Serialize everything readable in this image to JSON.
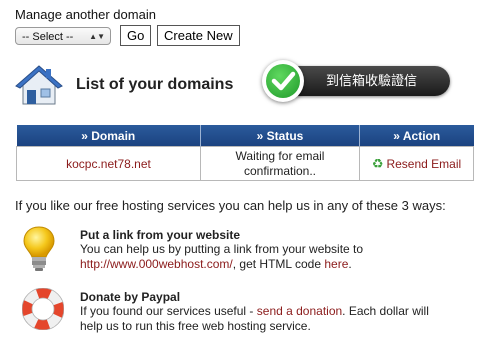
{
  "manage": {
    "label": "Manage another domain",
    "select_value": "-- Select --",
    "go_label": "Go",
    "create_label": "Create New"
  },
  "page_title": "List of your domains",
  "verify_badge": {
    "text": "到信箱收驗證信"
  },
  "table": {
    "headers": [
      "» Domain",
      "» Status",
      "» Action"
    ],
    "rows": [
      {
        "domain": "kocpc.net78.net",
        "status": "Waiting for email confirmation..",
        "action": "Resend Email"
      }
    ]
  },
  "help_line": "If you like our free hosting services you can help us in any of these 3 ways:",
  "ways": [
    {
      "icon": "lightbulb-icon",
      "title": "Put a link from your website",
      "text_1": "You can help us by putting a link from your website to",
      "link_url": "http://www.000webhost.com/",
      "text_2": ", get HTML code ",
      "link_here": "here",
      "text_3": "."
    },
    {
      "icon": "lifebuoy-icon",
      "title": "Donate by Paypal",
      "text_1": "If you found our services useful - ",
      "link_donate": "send a donation",
      "text_2": ". Each dollar will",
      "text_3": "help us to run this free web hosting service."
    }
  ],
  "colors": {
    "table_header": "#1b4280",
    "link": "#8b1b1b",
    "badge_green": "#1f9a2a"
  }
}
